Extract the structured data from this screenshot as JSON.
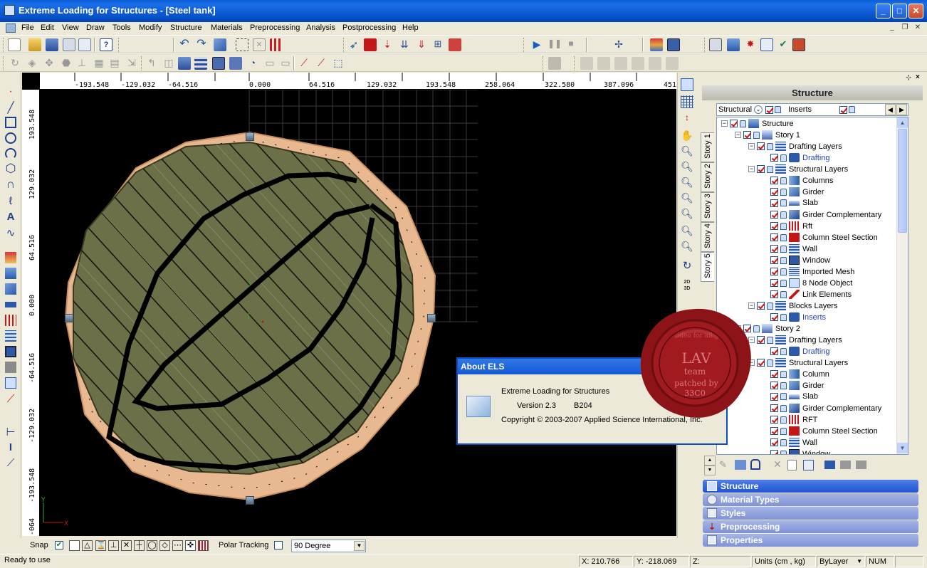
{
  "window": {
    "title": "Extreme Loading for Structures - [Steel tank]",
    "min_label": "_",
    "max_label": "□",
    "close_label": "✕"
  },
  "menu": [
    "File",
    "Edit",
    "View",
    "Draw",
    "Tools",
    "Modify",
    "Structure",
    "Materials",
    "Preprocessing",
    "Analysis",
    "Postprocessing",
    "Help"
  ],
  "mdi_controls": [
    "_",
    "❐",
    "✕"
  ],
  "ruler_h": [
    "-193.548",
    "-129.032",
    "-64.516",
    "0.000",
    "64.516",
    "129.032",
    "193.548",
    "258.064",
    "322.580",
    "387.096",
    "451"
  ],
  "ruler_v": [
    "193.548",
    "129.032",
    "64.516",
    "0.000",
    "-64.516",
    "-129.032",
    "-193.548",
    "-064"
  ],
  "story_tabs": [
    "Story 1",
    "Story 2",
    "Story 3",
    "Story 4",
    "Story 5"
  ],
  "panel": {
    "title": "Structure",
    "filter_left": "Structural",
    "filter_right": "Inserts"
  },
  "tree": [
    {
      "label": "Structure",
      "depth": 0,
      "exp": "−",
      "icon": "structure-icon",
      "color": "#000"
    },
    {
      "label": "Story 1",
      "depth": 1,
      "exp": "−",
      "icon": "story-icon",
      "color": "#000"
    },
    {
      "label": "Drafting Layers",
      "depth": 2,
      "exp": "−",
      "icon": "layers-icon",
      "color": "#000"
    },
    {
      "label": "Drafting",
      "depth": 3,
      "exp": "",
      "icon": "drafting-icon",
      "color": "#1f3fbf"
    },
    {
      "label": "Structural Layers",
      "depth": 2,
      "exp": "−",
      "icon": "layers-icon",
      "color": "#000"
    },
    {
      "label": "Columns",
      "depth": 3,
      "exp": "",
      "icon": "column-icon",
      "color": "#000"
    },
    {
      "label": "Girder",
      "depth": 3,
      "exp": "",
      "icon": "girder-icon",
      "color": "#000"
    },
    {
      "label": "Slab",
      "depth": 3,
      "exp": "",
      "icon": "slab-icon",
      "color": "#000"
    },
    {
      "label": "Girder Complementary",
      "depth": 3,
      "exp": "",
      "icon": "girder-comp-icon",
      "color": "#000"
    },
    {
      "label": "Rft",
      "depth": 3,
      "exp": "",
      "icon": "rft-icon",
      "color": "#000"
    },
    {
      "label": "Column Steel Section",
      "depth": 3,
      "exp": "",
      "icon": "steel-section-icon",
      "color": "#000"
    },
    {
      "label": "Wall",
      "depth": 3,
      "exp": "",
      "icon": "wall-icon",
      "color": "#000"
    },
    {
      "label": "Window",
      "depth": 3,
      "exp": "",
      "icon": "window-icon",
      "color": "#000"
    },
    {
      "label": "Imported Mesh",
      "depth": 3,
      "exp": "",
      "icon": "mesh-icon",
      "color": "#000"
    },
    {
      "label": "8 Node Object",
      "depth": 3,
      "exp": "",
      "icon": "node-object-icon",
      "color": "#000"
    },
    {
      "label": "Link Elements",
      "depth": 3,
      "exp": "",
      "icon": "link-icon",
      "color": "#000"
    },
    {
      "label": "Blocks Layers",
      "depth": 2,
      "exp": "−",
      "icon": "layers-icon",
      "color": "#000"
    },
    {
      "label": "Inserts",
      "depth": 3,
      "exp": "",
      "icon": "inserts-icon",
      "color": "#1f3fbf"
    },
    {
      "label": "Story 2",
      "depth": 1,
      "exp": "−",
      "icon": "story-icon",
      "color": "#000"
    },
    {
      "label": "Drafting Layers",
      "depth": 2,
      "exp": "−",
      "icon": "layers-icon",
      "color": "#000"
    },
    {
      "label": "Drafting",
      "depth": 3,
      "exp": "",
      "icon": "drafting-icon",
      "color": "#1f3fbf"
    },
    {
      "label": "Structural Layers",
      "depth": 2,
      "exp": "−",
      "icon": "layers-icon",
      "color": "#000"
    },
    {
      "label": "Column",
      "depth": 3,
      "exp": "",
      "icon": "column-icon",
      "color": "#000"
    },
    {
      "label": "Girder",
      "depth": 3,
      "exp": "",
      "icon": "girder-icon",
      "color": "#000"
    },
    {
      "label": "Slab",
      "depth": 3,
      "exp": "",
      "icon": "slab-icon",
      "color": "#000"
    },
    {
      "label": "Girder Complementary",
      "depth": 3,
      "exp": "",
      "icon": "girder-comp-icon",
      "color": "#000"
    },
    {
      "label": "RFT",
      "depth": 3,
      "exp": "",
      "icon": "rft-icon",
      "color": "#000"
    },
    {
      "label": "Column Steel Section",
      "depth": 3,
      "exp": "",
      "icon": "steel-section-icon",
      "color": "#000"
    },
    {
      "label": "Wall",
      "depth": 3,
      "exp": "",
      "icon": "wall-icon",
      "color": "#000"
    },
    {
      "label": "Window",
      "depth": 3,
      "exp": "",
      "icon": "window-icon",
      "color": "#000"
    }
  ],
  "nav_sections": [
    "Structure",
    "Material Types",
    "Styles",
    "Preprocessing",
    "Properties"
  ],
  "about": {
    "title": "About ELS",
    "product": "Extreme Loading for Structures",
    "version": "Version 2.3",
    "build": "B204",
    "copyright": "Copyright © 2003-2007 Applied Science International, Inc."
  },
  "seal": {
    "line1": "LAV",
    "line2": "team",
    "line3": "patched by",
    "line4": "33C0",
    "arc": "ideo for all"
  },
  "snap": {
    "label": "Snap",
    "polar_label": "Polar Tracking",
    "angle_value": "90 Degree"
  },
  "status": {
    "message": "Ready to use",
    "x": "X: 210.766",
    "y": "Y: -218.069",
    "z": "Z:",
    "units": "Units (cm , kg)",
    "layer": "ByLayer",
    "num": "NUM"
  },
  "colors": {
    "titlebar": "#0a5fd8",
    "tank_fill": "#6b7048",
    "tank_ring": "#e8b890",
    "canvas_bg": "#000000",
    "nav_active": "#2153d3",
    "seal": "#8c1418"
  }
}
